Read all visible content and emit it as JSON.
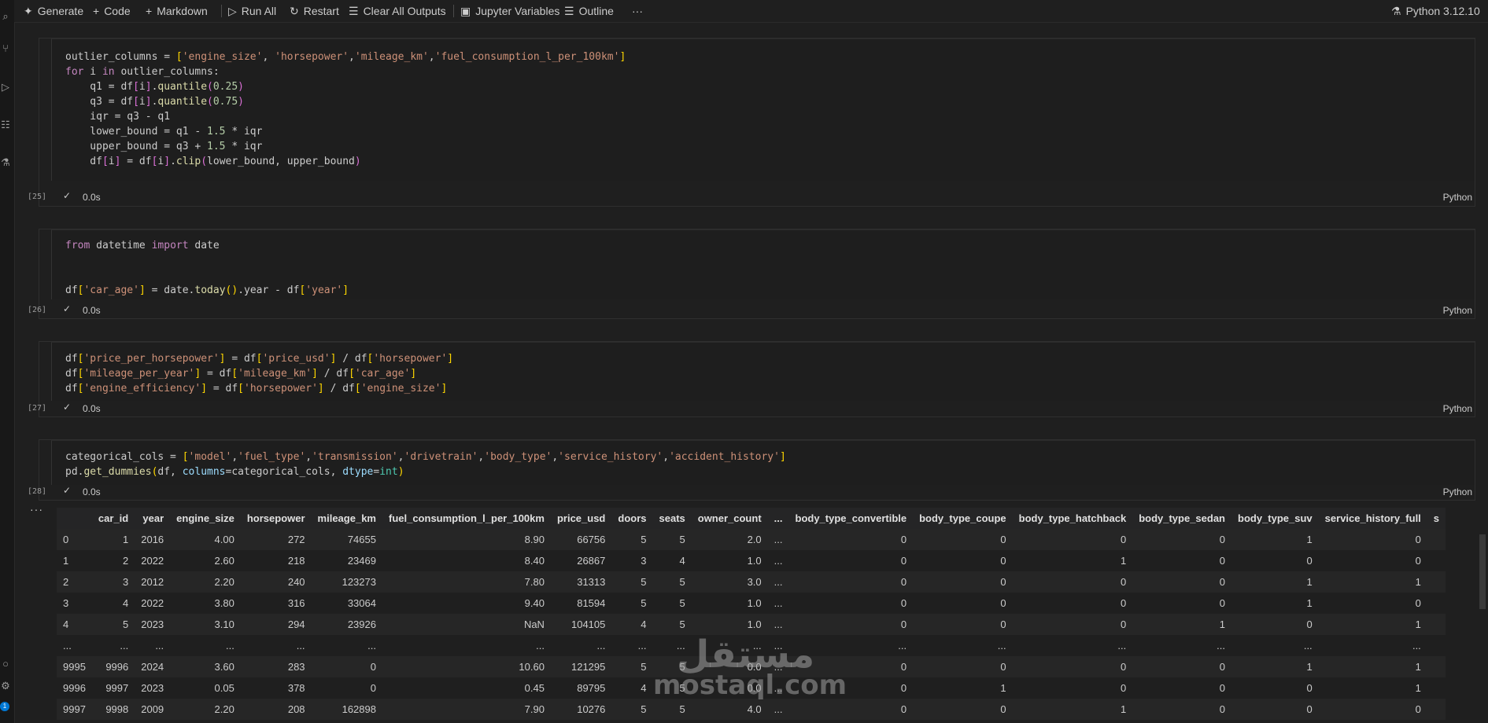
{
  "toolbar": {
    "generate": "Generate",
    "code": "Code",
    "markdown": "Markdown",
    "run_all": "Run All",
    "restart": "Restart",
    "clear_outputs": "Clear All Outputs",
    "variables": "Jupyter Variables",
    "outline": "Outline",
    "more": "···",
    "kernel": "Python 3.12.10"
  },
  "cells": [
    {
      "exec": "[25]",
      "time": "0.0s",
      "lang": "Python"
    },
    {
      "exec": "[26]",
      "time": "0.0s",
      "lang": "Python"
    },
    {
      "exec": "[27]",
      "time": "0.0s",
      "lang": "Python"
    },
    {
      "exec": "[28]",
      "time": "0.0s",
      "lang": "Python"
    }
  ],
  "code": {
    "c25": [
      "outlier_columns = ['engine_size', 'horsepower','mileage_km','fuel_consumption_l_per_100km']",
      "for i in outlier_columns:",
      "    q1 = df[i].quantile(0.25)",
      "    q3 = df[i].quantile(0.75)",
      "    iqr = q3 - q1",
      "    lower_bound = q1 - 1.5 * iqr",
      "    upper_bound = q3 + 1.5 * iqr",
      "    df[i] = df[i].clip(lower_bound, upper_bound)"
    ],
    "c26": [
      "from datetime import date",
      "",
      "",
      "df['car_age'] = date.today().year - df['year']"
    ],
    "c27": [
      "df['price_per_horsepower'] = df['price_usd'] / df['horsepower']",
      "df['mileage_per_year'] = df['mileage_km'] / df['car_age']",
      "df['engine_efficiency'] = df['horsepower'] / df['engine_size']"
    ],
    "c28": [
      "categorical_cols = ['model','fuel_type','transmission','drivetrain','body_type','service_history','accident_history']",
      "pd.get_dummies(df, columns=categorical_cols, dtype=int)"
    ]
  },
  "output": {
    "ellipsis": "···",
    "columns": [
      "",
      "car_id",
      "year",
      "engine_size",
      "horsepower",
      "mileage_km",
      "fuel_consumption_l_per_100km",
      "price_usd",
      "doors",
      "seats",
      "owner_count",
      "...",
      "body_type_convertible",
      "body_type_coupe",
      "body_type_hatchback",
      "body_type_sedan",
      "body_type_suv",
      "service_history_full",
      "s"
    ],
    "rows": [
      [
        "0",
        "1",
        "2016",
        "4.00",
        "272",
        "74655",
        "8.90",
        "66756",
        "5",
        "5",
        "2.0",
        "...",
        "0",
        "0",
        "0",
        "0",
        "1",
        "0",
        ""
      ],
      [
        "1",
        "2",
        "2022",
        "2.60",
        "218",
        "23469",
        "8.40",
        "26867",
        "3",
        "4",
        "1.0",
        "...",
        "0",
        "0",
        "1",
        "0",
        "0",
        "0",
        ""
      ],
      [
        "2",
        "3",
        "2012",
        "2.20",
        "240",
        "123273",
        "7.80",
        "31313",
        "5",
        "5",
        "3.0",
        "...",
        "0",
        "0",
        "0",
        "0",
        "1",
        "1",
        ""
      ],
      [
        "3",
        "4",
        "2022",
        "3.80",
        "316",
        "33064",
        "9.40",
        "81594",
        "5",
        "5",
        "1.0",
        "...",
        "0",
        "0",
        "0",
        "0",
        "1",
        "0",
        ""
      ],
      [
        "4",
        "5",
        "2023",
        "3.10",
        "294",
        "23926",
        "NaN",
        "104105",
        "4",
        "5",
        "1.0",
        "...",
        "0",
        "0",
        "0",
        "1",
        "0",
        "1",
        ""
      ],
      [
        "...",
        "...",
        "...",
        "...",
        "...",
        "...",
        "...",
        "...",
        "...",
        "...",
        "...",
        "...",
        "...",
        "...",
        "...",
        "...",
        "...",
        "...",
        ""
      ],
      [
        "9995",
        "9996",
        "2024",
        "3.60",
        "283",
        "0",
        "10.60",
        "121295",
        "5",
        "5",
        "0.0",
        "...",
        "0",
        "0",
        "0",
        "0",
        "1",
        "1",
        ""
      ],
      [
        "9996",
        "9997",
        "2023",
        "0.05",
        "378",
        "0",
        "0.45",
        "89795",
        "4",
        "5",
        "0.0",
        "...",
        "0",
        "1",
        "0",
        "0",
        "0",
        "1",
        ""
      ],
      [
        "9997",
        "9998",
        "2009",
        "2.20",
        "208",
        "162898",
        "7.90",
        "10276",
        "5",
        "5",
        "4.0",
        "...",
        "0",
        "0",
        "1",
        "0",
        "0",
        "0",
        ""
      ]
    ]
  },
  "activity": {
    "badge": "1"
  },
  "watermark": {
    "arabic": "مستقل",
    "url": "mostaql.com"
  },
  "colors": {
    "keyword": "#c586c0",
    "string": "#ce9178",
    "number": "#b5cea8",
    "function": "#dcdcaa",
    "variable": "#9cdcfe",
    "accent": "#0078d4"
  }
}
